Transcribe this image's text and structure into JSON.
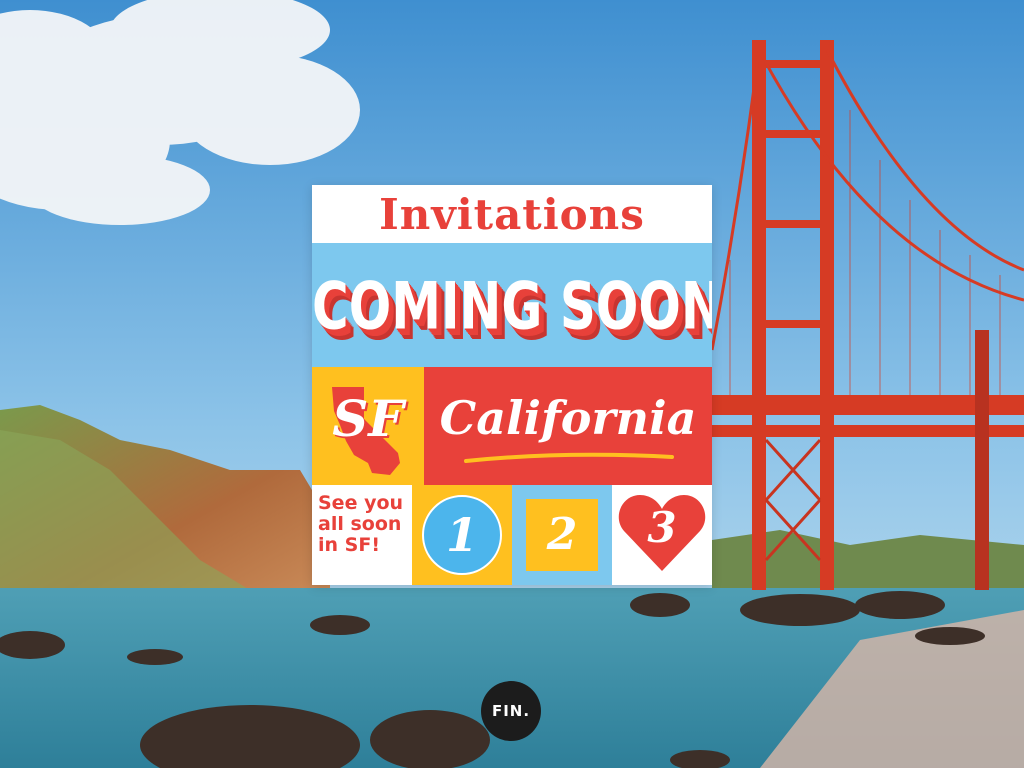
{
  "colors": {
    "red": "#e8413a",
    "yellow": "#ffc01f",
    "sky": "#7dc8ee",
    "blue": "#4cb5ec",
    "white": "#ffffff",
    "dark": "#1c1c1c"
  },
  "background": {
    "description_icon": "golden-gate-bridge-photo"
  },
  "card": {
    "title": "Invitations",
    "headline": "COMING SOON",
    "city": "SF",
    "state": "California",
    "state_shape_icon": "california-state-icon",
    "message": "See you all soon in SF!",
    "steps": [
      {
        "label": "1",
        "shape": "circle"
      },
      {
        "label": "2",
        "shape": "square"
      },
      {
        "label": "3",
        "shape": "heart"
      }
    ]
  },
  "nav": {
    "fin_label": "FIN."
  }
}
